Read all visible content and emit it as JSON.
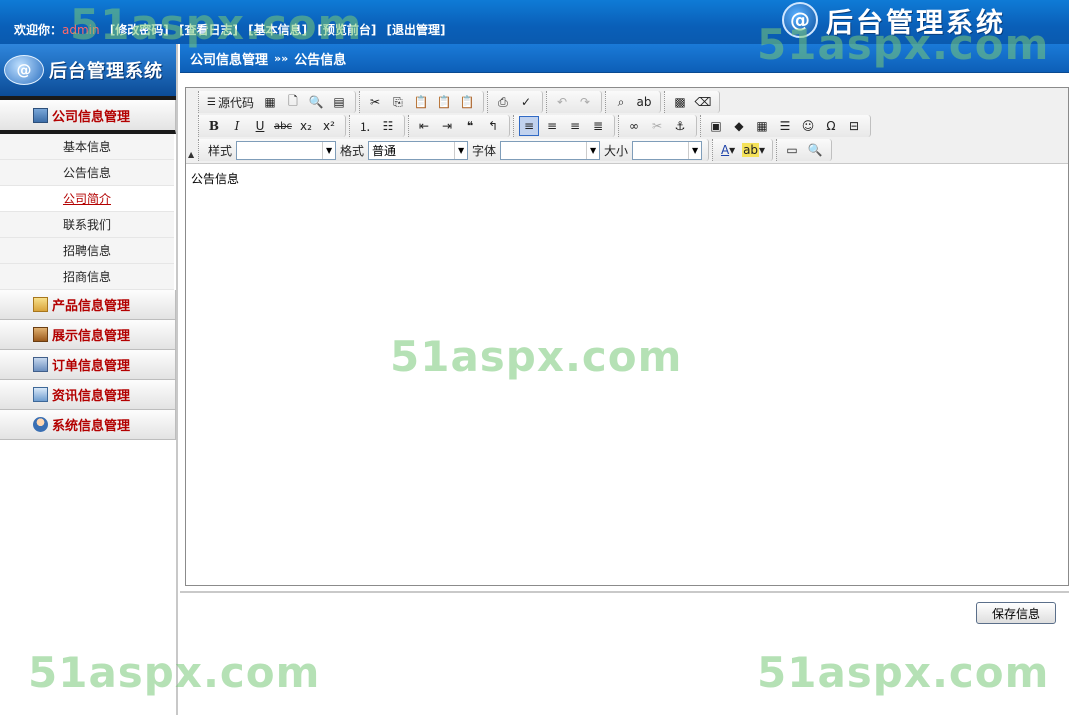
{
  "header": {
    "welcome_label": "欢迎你：",
    "username": "admin",
    "links": [
      "[修改密码]",
      "[查看日志]",
      "[基本信息]",
      "[预览前台]",
      "[退出管理]"
    ],
    "brand_logo_text": "@",
    "brand_title": "后台管理系统"
  },
  "sidebar": {
    "logo_text": "@",
    "title": "后台管理系统",
    "groups": [
      {
        "label": "公司信息管理",
        "icon": "company-icon",
        "open": true,
        "items": [
          "基本信息",
          "公告信息",
          "公司简介",
          "联系我们",
          "招聘信息",
          "招商信息"
        ],
        "active_item": "公司简介"
      },
      {
        "label": "产品信息管理",
        "icon": "product-icon"
      },
      {
        "label": "展示信息管理",
        "icon": "showcase-icon"
      },
      {
        "label": "订单信息管理",
        "icon": "order-icon"
      },
      {
        "label": "资讯信息管理",
        "icon": "news-icon"
      },
      {
        "label": "系统信息管理",
        "icon": "system-icon"
      }
    ]
  },
  "breadcrumb": {
    "section": "公司信息管理",
    "separator": "»»",
    "page": "公告信息"
  },
  "editor": {
    "toolbar": {
      "source_label": "源代码",
      "style_label": "样式",
      "style_value": "",
      "format_label": "格式",
      "format_value": "普通",
      "font_label": "字体",
      "font_value": "",
      "size_label": "大小",
      "size_value": ""
    },
    "content": "公告信息"
  },
  "save_label": "保存信息",
  "watermark": "51aspx.com"
}
